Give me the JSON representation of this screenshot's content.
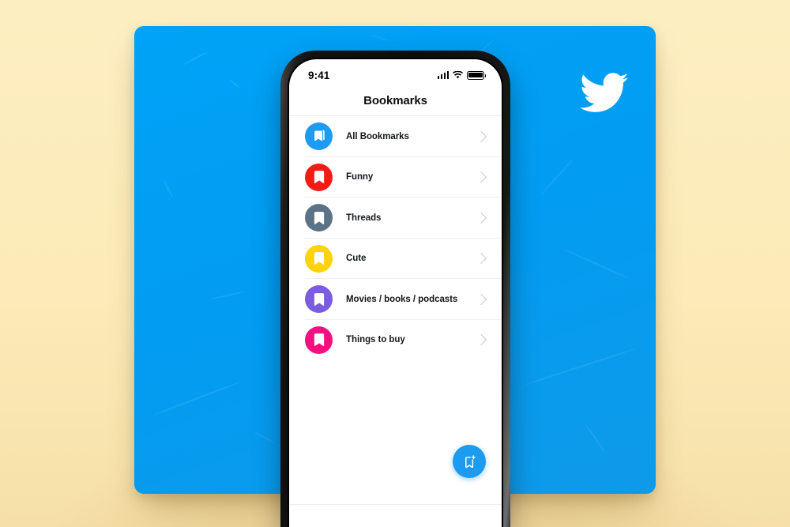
{
  "scene": {
    "background_color": "#fcebb8",
    "card_color": "#029cf2",
    "brand_logo": "twitter-bird-icon"
  },
  "phone": {
    "status_bar": {
      "time": "9:41",
      "icons": [
        "cellular-signal-icon",
        "wifi-icon",
        "battery-icon"
      ]
    },
    "header": {
      "title": "Bookmarks"
    },
    "list": {
      "items": [
        {
          "label": "All Bookmarks",
          "color": "#1d9bf0",
          "icon": "bookmarks-stack-icon",
          "chevron": "chevron-right-icon"
        },
        {
          "label": "Funny",
          "color": "#f41b17",
          "icon": "bookmark-icon",
          "chevron": "chevron-right-icon"
        },
        {
          "label": "Threads",
          "color": "#5b7386",
          "icon": "bookmark-icon",
          "chevron": "chevron-right-icon"
        },
        {
          "label": "Cute",
          "color": "#fdd30a",
          "icon": "bookmark-icon",
          "chevron": "chevron-right-icon"
        },
        {
          "label": "Movies / books / podcasts",
          "color": "#7a5cde",
          "icon": "bookmark-icon",
          "chevron": "chevron-right-icon"
        },
        {
          "label": "Things to buy",
          "color": "#f5107f",
          "icon": "bookmark-icon",
          "chevron": "chevron-right-icon"
        }
      ]
    },
    "fab": {
      "icon": "add-bookmark-icon",
      "color": "#1d9bf0"
    }
  }
}
